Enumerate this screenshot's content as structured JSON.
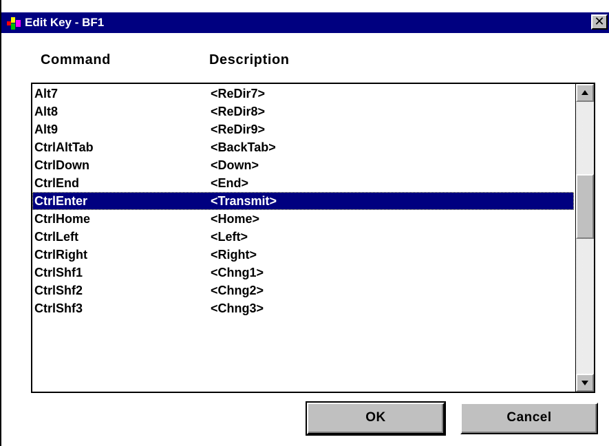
{
  "window": {
    "title": "Edit Key - BF1",
    "close_label": "✕",
    "title_icon": "app-icon",
    "close_icon": "close-icon"
  },
  "columns": {
    "command": "Command",
    "description": "Description"
  },
  "rows": [
    {
      "command": "Alt7",
      "description": "<ReDir7>",
      "selected": false
    },
    {
      "command": "Alt8",
      "description": "<ReDir8>",
      "selected": false
    },
    {
      "command": "Alt9",
      "description": "<ReDir9>",
      "selected": false
    },
    {
      "command": "CtrlAltTab",
      "description": "<BackTab>",
      "selected": false
    },
    {
      "command": "CtrlDown",
      "description": "<Down>",
      "selected": false
    },
    {
      "command": "CtrlEnd",
      "description": "<End>",
      "selected": false
    },
    {
      "command": "CtrlEnter",
      "description": "<Transmit>",
      "selected": true
    },
    {
      "command": "CtrlHome",
      "description": "<Home>",
      "selected": false
    },
    {
      "command": "CtrlLeft",
      "description": "<Left>",
      "selected": false
    },
    {
      "command": "CtrlRight",
      "description": "<Right>",
      "selected": false
    },
    {
      "command": "CtrlShf1",
      "description": "<Chng1>",
      "selected": false
    },
    {
      "command": "CtrlShf2",
      "description": "<Chng2>",
      "selected": false
    },
    {
      "command": "CtrlShf3",
      "description": "<Chng3>",
      "selected": false
    }
  ],
  "scrollbar": {
    "up_icon": "scroll-up-arrow-icon",
    "down_icon": "scroll-down-arrow-icon",
    "position_fraction": 0.35
  },
  "buttons": {
    "ok": "OK",
    "cancel": "Cancel"
  },
  "colors": {
    "titlebar": "#000080",
    "selection": "#000080",
    "face": "#c0c0c0"
  }
}
